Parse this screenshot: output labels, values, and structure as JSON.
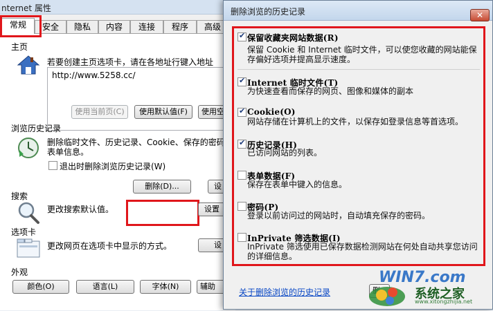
{
  "options_window": {
    "title": "nternet 属性",
    "tabs": [
      "常规",
      "安全",
      "隐私",
      "内容",
      "连接",
      "程序",
      "高级"
    ],
    "homepage": {
      "section_label": "主页",
      "hint": "若要创建主页选项卡，请在各地址行键入地址",
      "url": "http://www.5258.cc/",
      "use_current": "使用当前页(C)",
      "use_default": "使用默认值(F)",
      "use_blank": "使用空"
    },
    "history": {
      "section_label": "浏览历史记录",
      "desc": "删除临时文件、历史记录、Cookie、保存的密码",
      "desc2": "表单信息。",
      "delete_on_exit": "退出时删除浏览历史记录(W)",
      "delete_button": "删除(D)...",
      "settings_button": "设"
    },
    "search": {
      "section_label": "搜索",
      "desc": "更改搜索默认值。",
      "settings_button": "设置"
    },
    "tabs_section": {
      "section_label": "选项卡",
      "desc": "更改网页在选项卡中显示的方式。",
      "settings_button": "设"
    },
    "appearance": {
      "section_label": "外观",
      "colors": "颜色(O)",
      "languages": "语言(L)",
      "fonts": "字体(N)",
      "accessibility": "辅助"
    }
  },
  "delete_dialog": {
    "title": "删除浏览的历史记录",
    "options": [
      {
        "title": "保留收藏夹网站数据(R)",
        "desc": "保留 Cookie 和 Internet 临时文件，可以使您收藏的网站能保存偏好选项并提高显示速度。",
        "checked": true
      },
      {
        "title": "Internet 临时文件(T)",
        "desc": "为快速查看而保存的网页、图像和媒体的副本",
        "checked": true
      },
      {
        "title": "Cookie(O)",
        "desc": "网站存储在计算机上的文件，以保存如登录信息等首选项。",
        "checked": true
      },
      {
        "title": "历史记录(H)",
        "desc": "已访问网站的列表。",
        "checked": true
      },
      {
        "title": "表单数据(F)",
        "desc": "保存在表单中键入的信息。",
        "checked": false
      },
      {
        "title": "密码(P)",
        "desc": "登录以前访问过的网站时，自动填充保存的密码。",
        "checked": false
      },
      {
        "title": "InPrivate 筛选数据(I)",
        "desc": "InPrivate 筛选使用已保存数据检测网站在何处自动共享您访问的详细信息。",
        "checked": false
      }
    ],
    "about_link": "关于删除浏览的历史记录",
    "delete_button": "删"
  },
  "watermark": {
    "brand": "WIN7.com",
    "site_name": "系统之家",
    "url": "www.xitongzhijia.net"
  },
  "colors": {
    "highlight_red": "#e0161b",
    "link_blue": "#0645c4"
  }
}
